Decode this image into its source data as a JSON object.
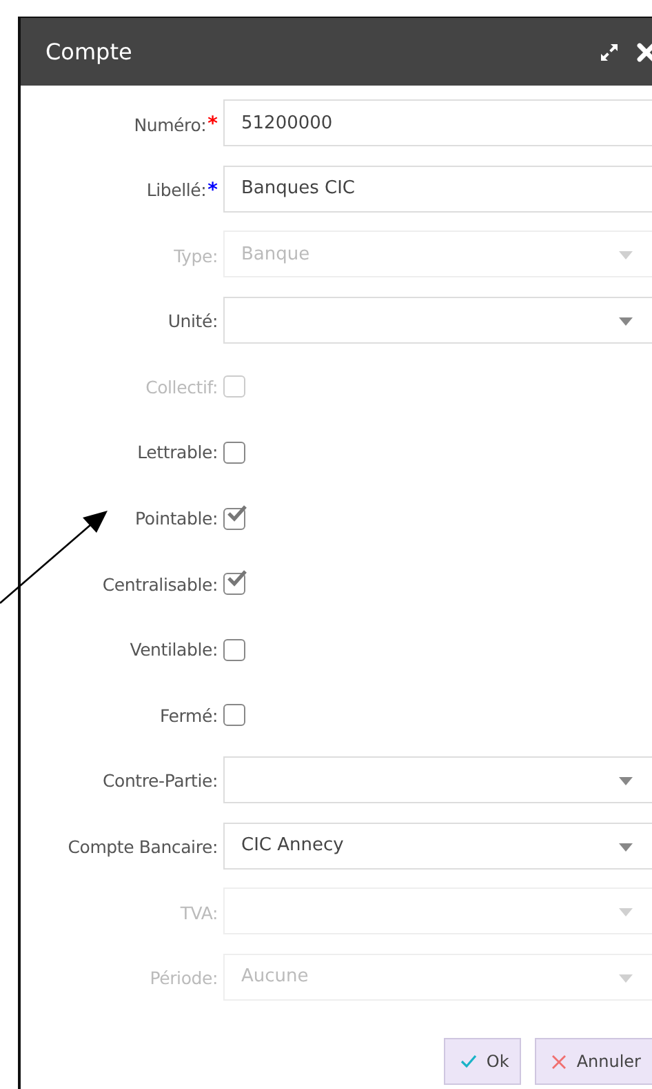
{
  "window": {
    "title": "Compte"
  },
  "fields": [
    {
      "kind": "text",
      "label": "Numéro:",
      "marker": "*",
      "color": "#ff0000",
      "value": "51200000",
      "disabled": false
    },
    {
      "kind": "text",
      "label": "Libellé:",
      "marker": "*",
      "color": "#0000ff",
      "value": "Banques CIC",
      "disabled": false
    },
    {
      "kind": "select",
      "label": "Type:",
      "value": "Banque",
      "disabled": true
    },
    {
      "kind": "select",
      "label": "Unité:",
      "disabled": false
    },
    {
      "kind": "checkbox",
      "label": "Collectif:",
      "checked": false,
      "disabled": true
    },
    {
      "kind": "checkbox",
      "label": "Lettrable:",
      "checked": false,
      "disabled": false
    },
    {
      "kind": "checkbox",
      "label": "Pointable:",
      "checked": true,
      "disabled": false
    },
    {
      "kind": "checkbox",
      "label": "Centralisable:",
      "checked": true,
      "disabled": false
    },
    {
      "kind": "checkbox",
      "label": "Ventilable:",
      "checked": false,
      "disabled": false
    },
    {
      "kind": "checkbox",
      "label": "Fermé:",
      "checked": false,
      "disabled": false
    },
    {
      "kind": "select",
      "label": "Contre-Partie:",
      "disabled": false
    },
    {
      "kind": "select",
      "label": "Compte Bancaire:",
      "value": "CIC Annecy",
      "disabled": false
    },
    {
      "kind": "select",
      "label": "TVA:",
      "disabled": true
    },
    {
      "kind": "select",
      "label": "Période:",
      "value": "Aucune",
      "disabled": true
    }
  ],
  "buttons": [
    {
      "kind": "ok",
      "label": "Ok"
    },
    {
      "kind": "cancel",
      "label": "Annuler"
    }
  ]
}
